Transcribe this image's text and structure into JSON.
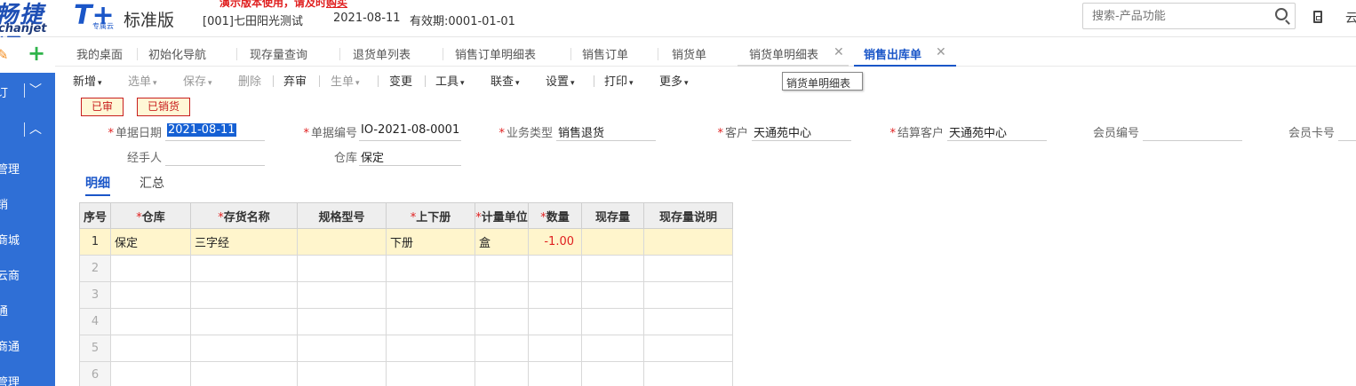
{
  "header": {
    "logo_big": "畅捷通",
    "logo_small": "chanjet",
    "tplus": "T+",
    "tplus_sub": "专属云",
    "edition": "标准版",
    "demo_warning": "演示版本使用，请及时",
    "demo_link": "购买",
    "account": "[001]七田阳光测试",
    "date": "2021-08-11",
    "validity": "有效期:0001-01-01",
    "search_placeholder": "搜索-产品功能",
    "edge_glyph": "云"
  },
  "sidebar": {
    "row1": "订",
    "items": [
      "管理",
      "销",
      "商城",
      "云商",
      "通",
      "商通",
      "管理"
    ]
  },
  "tabs": [
    {
      "label": "我的桌面"
    },
    {
      "label": "初始化导航"
    },
    {
      "label": "现存量查询"
    },
    {
      "label": "退货单列表"
    },
    {
      "label": "销售订单明细表"
    },
    {
      "label": "销售订单"
    },
    {
      "label": "销货单"
    },
    {
      "label": "销货单明细表"
    },
    {
      "label": "销售出库单"
    }
  ],
  "toolbar": {
    "new": "新增",
    "select": "选单",
    "save": "保存",
    "delete": "删除",
    "unaudit": "弃审",
    "generate": "生单",
    "change": "变更",
    "tools": "工具",
    "linked": "联查",
    "settings": "设置",
    "print": "打印",
    "more": "更多",
    "caret": "▾",
    "tooltip": "销货单明细表"
  },
  "badges": {
    "audited": "已审",
    "sold": "已销货"
  },
  "form": {
    "date_label": "单据日期",
    "date_value": "2021-08-11",
    "code_label": "单据编号",
    "code_value": "IO-2021-08-0001",
    "biztype_label": "业务类型",
    "biztype_value": "销售退货",
    "customer_label": "客户",
    "customer_value": "天通苑中心",
    "settle_label": "结算客户",
    "settle_value": "天通苑中心",
    "member_no_label": "会员编号",
    "member_card_label": "会员卡号",
    "handler_label": "经手人",
    "warehouse_label": "仓库",
    "warehouse_value": "保定"
  },
  "subtabs": {
    "detail": "明细",
    "summary": "汇总"
  },
  "grid": {
    "columns": [
      "序号",
      "仓库",
      "存货名称",
      "规格型号",
      "上下册",
      "计量单位",
      "数量",
      "现存量",
      "现存量说明"
    ],
    "rows": [
      {
        "no": "1",
        "warehouse": "保定",
        "name": "三字经",
        "spec": "",
        "volume": "下册",
        "unit": "盒",
        "qty": "-1.00",
        "stock": "",
        "stock_note": ""
      },
      {
        "no": "2"
      },
      {
        "no": "3"
      },
      {
        "no": "4"
      },
      {
        "no": "5"
      },
      {
        "no": "6"
      }
    ]
  }
}
